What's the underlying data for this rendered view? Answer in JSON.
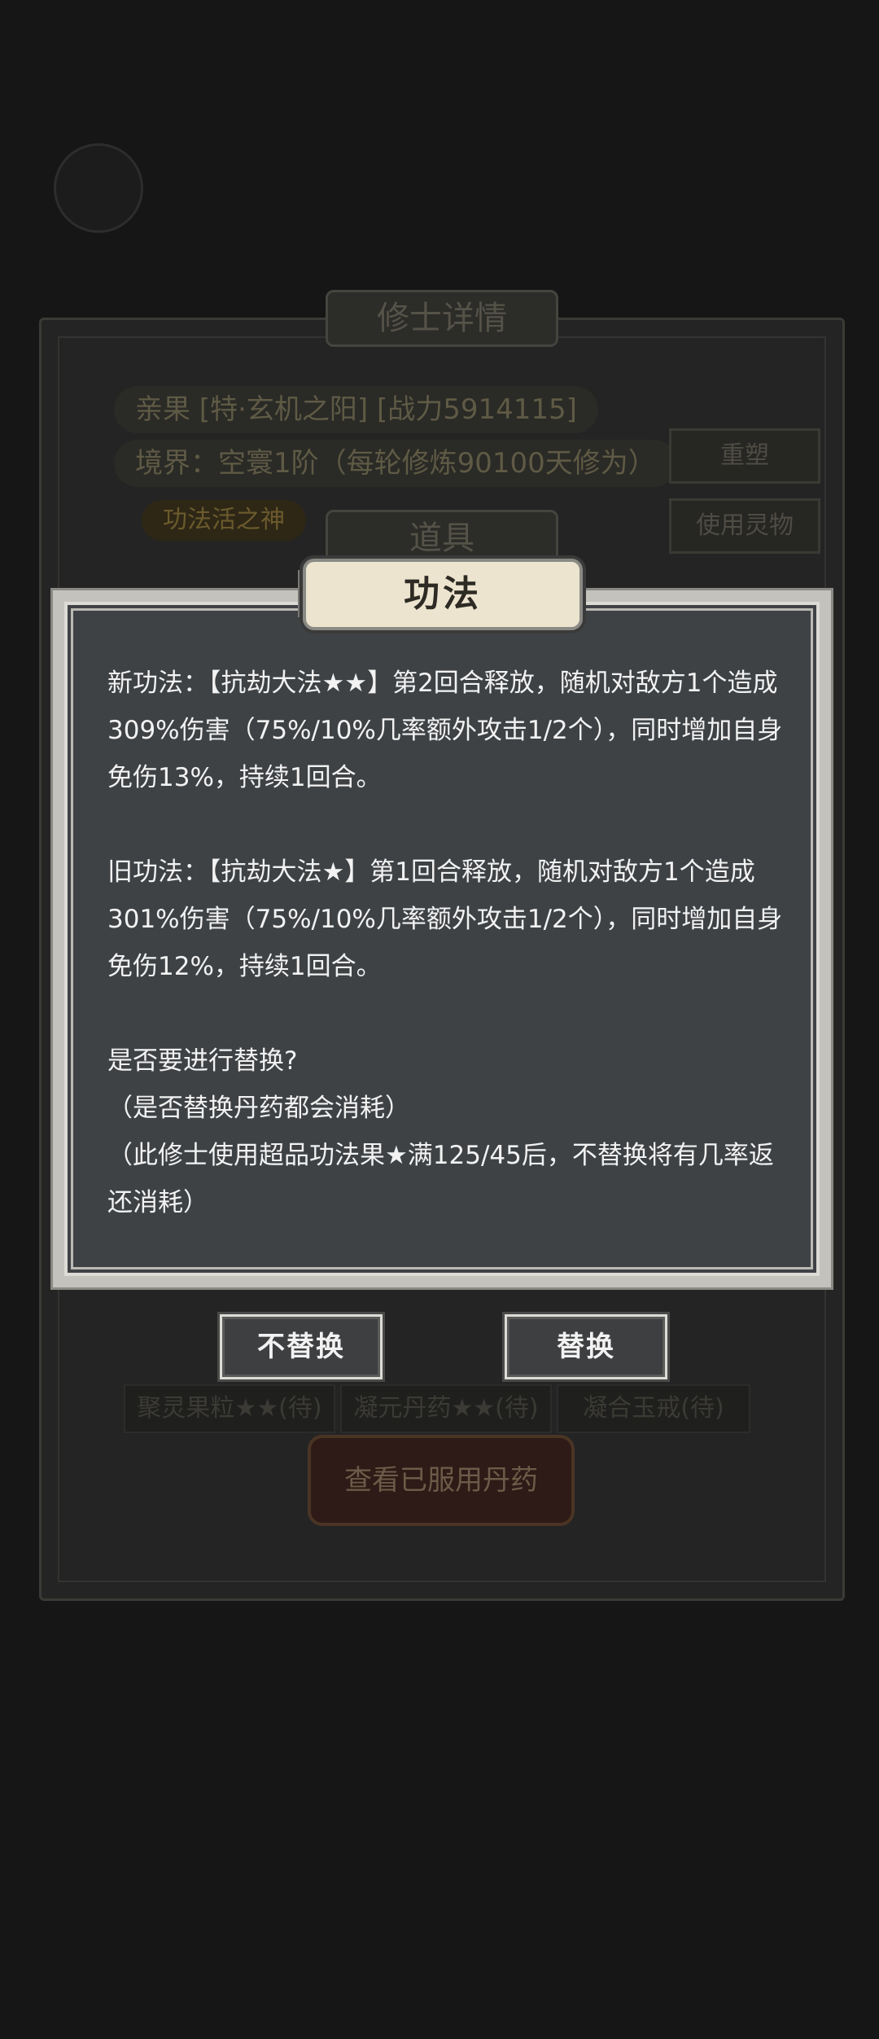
{
  "background": {
    "panel_title": "修士详情",
    "name_row": "亲果 [特·玄机之阳] [战力5914115]",
    "realm_row": "境界：空寰1阶（每轮修炼90100天修为）",
    "reset_button": "重塑",
    "use_item_button": "使用灵物",
    "pill_label": "功法活之神",
    "items_tab": "道具",
    "item_chips": [
      "聚灵果粒★★(待)",
      "凝元丹药★★(待)",
      "凝合玉戒(待)"
    ],
    "view_pills_button": "查看已服用丹药"
  },
  "dialog": {
    "title": "功法",
    "new_skill": "新功法：【抗劫大法★★】第2回合释放，随机对敌方1个造成309%伤害（75%/10%几率额外攻击1/2个），同时增加自身免伤13%，持续1回合。",
    "old_skill": "旧功法：【抗劫大法★】第1回合释放，随机对敌方1个造成301%伤害（75%/10%几率额外攻击1/2个），同时增加自身免伤12%，持续1回合。",
    "question": "是否要进行替换?",
    "note_1": "（是否替换丹药都会消耗）",
    "note_2": "（此修士使用超品功法果★满125/45后，不替换将有几率返还消耗）",
    "no_replace_button": "不替换",
    "replace_button": "替换"
  }
}
